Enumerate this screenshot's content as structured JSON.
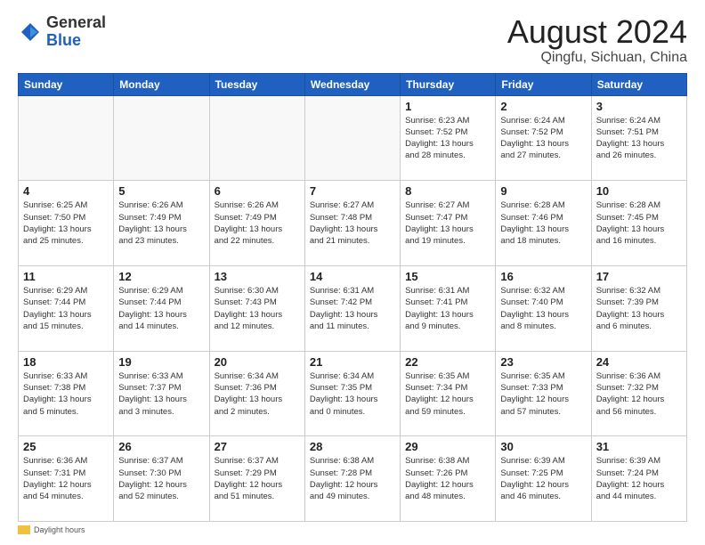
{
  "header": {
    "logo_general": "General",
    "logo_blue": "Blue",
    "main_title": "August 2024",
    "subtitle": "Qingfu, Sichuan, China"
  },
  "calendar": {
    "headers": [
      "Sunday",
      "Monday",
      "Tuesday",
      "Wednesday",
      "Thursday",
      "Friday",
      "Saturday"
    ],
    "weeks": [
      [
        {
          "day": "",
          "info": ""
        },
        {
          "day": "",
          "info": ""
        },
        {
          "day": "",
          "info": ""
        },
        {
          "day": "",
          "info": ""
        },
        {
          "day": "1",
          "info": "Sunrise: 6:23 AM\nSunset: 7:52 PM\nDaylight: 13 hours\nand 28 minutes."
        },
        {
          "day": "2",
          "info": "Sunrise: 6:24 AM\nSunset: 7:52 PM\nDaylight: 13 hours\nand 27 minutes."
        },
        {
          "day": "3",
          "info": "Sunrise: 6:24 AM\nSunset: 7:51 PM\nDaylight: 13 hours\nand 26 minutes."
        }
      ],
      [
        {
          "day": "4",
          "info": "Sunrise: 6:25 AM\nSunset: 7:50 PM\nDaylight: 13 hours\nand 25 minutes."
        },
        {
          "day": "5",
          "info": "Sunrise: 6:26 AM\nSunset: 7:49 PM\nDaylight: 13 hours\nand 23 minutes."
        },
        {
          "day": "6",
          "info": "Sunrise: 6:26 AM\nSunset: 7:49 PM\nDaylight: 13 hours\nand 22 minutes."
        },
        {
          "day": "7",
          "info": "Sunrise: 6:27 AM\nSunset: 7:48 PM\nDaylight: 13 hours\nand 21 minutes."
        },
        {
          "day": "8",
          "info": "Sunrise: 6:27 AM\nSunset: 7:47 PM\nDaylight: 13 hours\nand 19 minutes."
        },
        {
          "day": "9",
          "info": "Sunrise: 6:28 AM\nSunset: 7:46 PM\nDaylight: 13 hours\nand 18 minutes."
        },
        {
          "day": "10",
          "info": "Sunrise: 6:28 AM\nSunset: 7:45 PM\nDaylight: 13 hours\nand 16 minutes."
        }
      ],
      [
        {
          "day": "11",
          "info": "Sunrise: 6:29 AM\nSunset: 7:44 PM\nDaylight: 13 hours\nand 15 minutes."
        },
        {
          "day": "12",
          "info": "Sunrise: 6:29 AM\nSunset: 7:44 PM\nDaylight: 13 hours\nand 14 minutes."
        },
        {
          "day": "13",
          "info": "Sunrise: 6:30 AM\nSunset: 7:43 PM\nDaylight: 13 hours\nand 12 minutes."
        },
        {
          "day": "14",
          "info": "Sunrise: 6:31 AM\nSunset: 7:42 PM\nDaylight: 13 hours\nand 11 minutes."
        },
        {
          "day": "15",
          "info": "Sunrise: 6:31 AM\nSunset: 7:41 PM\nDaylight: 13 hours\nand 9 minutes."
        },
        {
          "day": "16",
          "info": "Sunrise: 6:32 AM\nSunset: 7:40 PM\nDaylight: 13 hours\nand 8 minutes."
        },
        {
          "day": "17",
          "info": "Sunrise: 6:32 AM\nSunset: 7:39 PM\nDaylight: 13 hours\nand 6 minutes."
        }
      ],
      [
        {
          "day": "18",
          "info": "Sunrise: 6:33 AM\nSunset: 7:38 PM\nDaylight: 13 hours\nand 5 minutes."
        },
        {
          "day": "19",
          "info": "Sunrise: 6:33 AM\nSunset: 7:37 PM\nDaylight: 13 hours\nand 3 minutes."
        },
        {
          "day": "20",
          "info": "Sunrise: 6:34 AM\nSunset: 7:36 PM\nDaylight: 13 hours\nand 2 minutes."
        },
        {
          "day": "21",
          "info": "Sunrise: 6:34 AM\nSunset: 7:35 PM\nDaylight: 13 hours\nand 0 minutes."
        },
        {
          "day": "22",
          "info": "Sunrise: 6:35 AM\nSunset: 7:34 PM\nDaylight: 12 hours\nand 59 minutes."
        },
        {
          "day": "23",
          "info": "Sunrise: 6:35 AM\nSunset: 7:33 PM\nDaylight: 12 hours\nand 57 minutes."
        },
        {
          "day": "24",
          "info": "Sunrise: 6:36 AM\nSunset: 7:32 PM\nDaylight: 12 hours\nand 56 minutes."
        }
      ],
      [
        {
          "day": "25",
          "info": "Sunrise: 6:36 AM\nSunset: 7:31 PM\nDaylight: 12 hours\nand 54 minutes."
        },
        {
          "day": "26",
          "info": "Sunrise: 6:37 AM\nSunset: 7:30 PM\nDaylight: 12 hours\nand 52 minutes."
        },
        {
          "day": "27",
          "info": "Sunrise: 6:37 AM\nSunset: 7:29 PM\nDaylight: 12 hours\nand 51 minutes."
        },
        {
          "day": "28",
          "info": "Sunrise: 6:38 AM\nSunset: 7:28 PM\nDaylight: 12 hours\nand 49 minutes."
        },
        {
          "day": "29",
          "info": "Sunrise: 6:38 AM\nSunset: 7:26 PM\nDaylight: 12 hours\nand 48 minutes."
        },
        {
          "day": "30",
          "info": "Sunrise: 6:39 AM\nSunset: 7:25 PM\nDaylight: 12 hours\nand 46 minutes."
        },
        {
          "day": "31",
          "info": "Sunrise: 6:39 AM\nSunset: 7:24 PM\nDaylight: 12 hours\nand 44 minutes."
        }
      ]
    ]
  },
  "footer": {
    "daylight_label": "Daylight hours"
  }
}
